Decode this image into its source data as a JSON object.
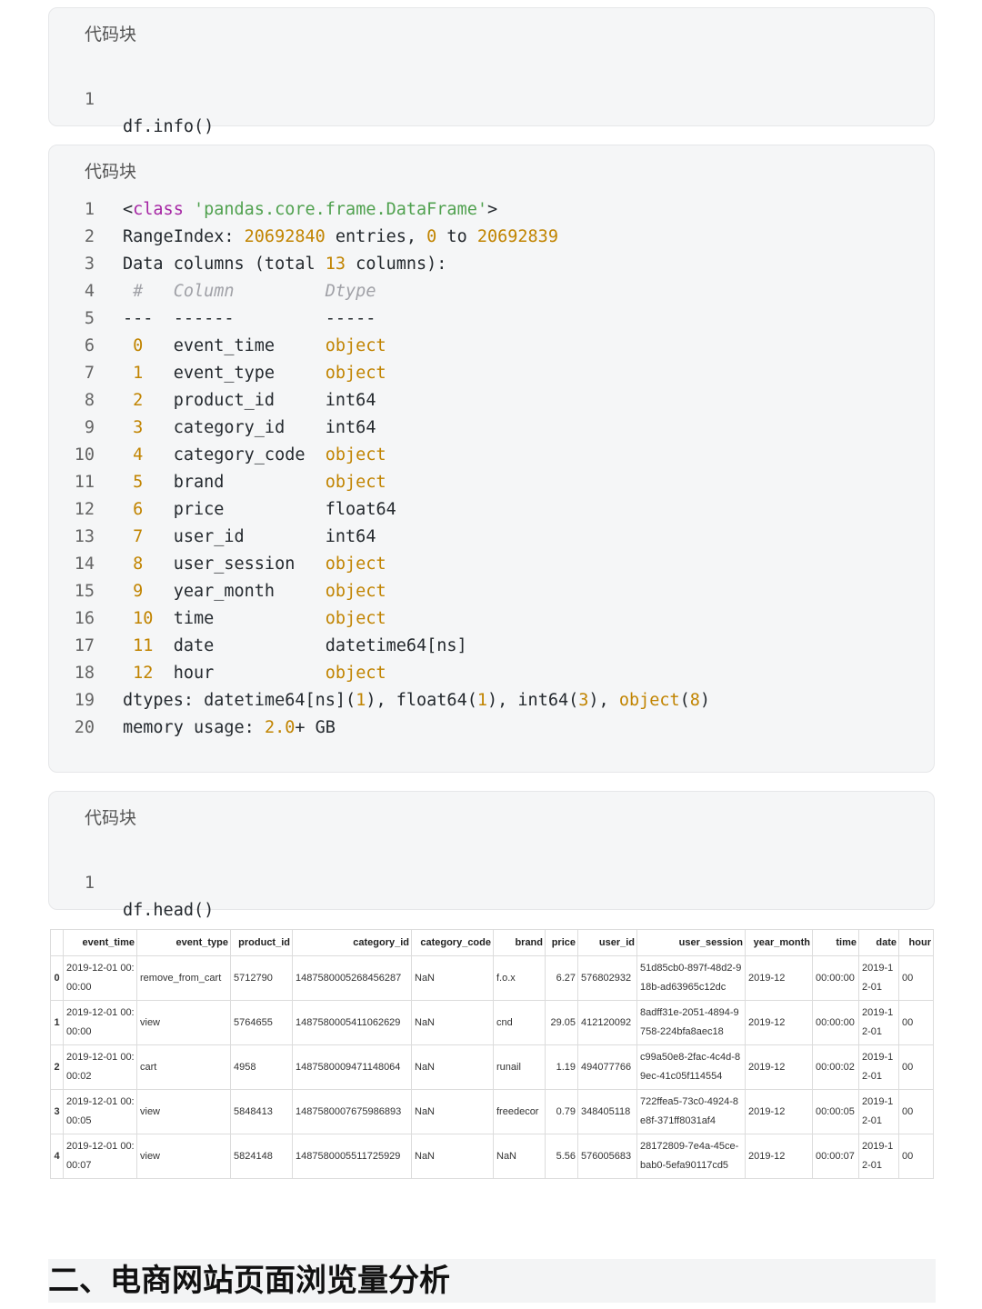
{
  "block_label": "代码块",
  "code1": {
    "lines": [
      "df.info()"
    ]
  },
  "code2": {
    "lines": [
      [
        "1",
        "<class 'pandas.core.frame.DataFrame'>"
      ],
      [
        "2",
        "RangeIndex: 20692840 entries, 0 to 20692839"
      ],
      [
        "3",
        "Data columns (total 13 columns):"
      ],
      [
        "4",
        " #   Column         Dtype"
      ],
      [
        "5",
        "---  ------         -----"
      ],
      [
        "6",
        " 0   event_time     object"
      ],
      [
        "7",
        " 1   event_type     object"
      ],
      [
        "8",
        " 2   product_id     int64"
      ],
      [
        "9",
        " 3   category_id    int64"
      ],
      [
        "10",
        " 4   category_code  object"
      ],
      [
        "11",
        " 5   brand          object"
      ],
      [
        "12",
        " 6   price          float64"
      ],
      [
        "13",
        " 7   user_id        int64"
      ],
      [
        "14",
        " 8   user_session   object"
      ],
      [
        "15",
        " 9   year_month     object"
      ],
      [
        "16",
        " 10  time           object"
      ],
      [
        "17",
        " 11  date           datetime64[ns]"
      ],
      [
        "18",
        " 12  hour           object"
      ],
      [
        "19",
        "dtypes: datetime64[ns](1), float64(1), int64(3), object(8)"
      ],
      [
        "20",
        "memory usage: 2.0+ GB"
      ]
    ]
  },
  "code3": {
    "lines": [
      "df.head()"
    ]
  },
  "dataframe": {
    "columns": [
      "",
      "event_time",
      "event_type",
      "product_id",
      "category_id",
      "category_code",
      "brand",
      "price",
      "user_id",
      "user_session",
      "year_month",
      "time",
      "date",
      "hour"
    ],
    "rows": [
      [
        "0",
        "2019-12-01 00:00:00",
        "remove_from_cart",
        "5712790",
        "1487580005268456287",
        "NaN",
        "f.o.x",
        "6.27",
        "576802932",
        "51d85cb0-897f-48d2-918b-ad63965c12dc",
        "2019-12",
        "00:00:00",
        "2019-12-01",
        "00"
      ],
      [
        "1",
        "2019-12-01 00:00:00",
        "view",
        "5764655",
        "1487580005411062629",
        "NaN",
        "cnd",
        "29.05",
        "412120092",
        "8adff31e-2051-4894-9758-224bfa8aec18",
        "2019-12",
        "00:00:00",
        "2019-12-01",
        "00"
      ],
      [
        "2",
        "2019-12-01 00:00:02",
        "cart",
        "4958",
        "1487580009471148064",
        "NaN",
        "runail",
        "1.19",
        "494077766",
        "c99a50e8-2fac-4c4d-89ec-41c05f114554",
        "2019-12",
        "00:00:02",
        "2019-12-01",
        "00"
      ],
      [
        "3",
        "2019-12-01 00:00:05",
        "view",
        "5848413",
        "1487580007675986893",
        "NaN",
        "freedecor",
        "0.79",
        "348405118",
        "722ffea5-73c0-4924-8e8f-371ff8031af4",
        "2019-12",
        "00:00:05",
        "2019-12-01",
        "00"
      ],
      [
        "4",
        "2019-12-01 00:00:07",
        "view",
        "5824148",
        "1487580005511725929",
        "NaN",
        "NaN",
        "5.56",
        "576005683",
        "28172809-7e4a-45ce-bab0-5efa90117cd5",
        "2019-12",
        "00:00:07",
        "2019-12-01",
        "00"
      ]
    ]
  },
  "section_title": "二、电商网站页面浏览量分析"
}
